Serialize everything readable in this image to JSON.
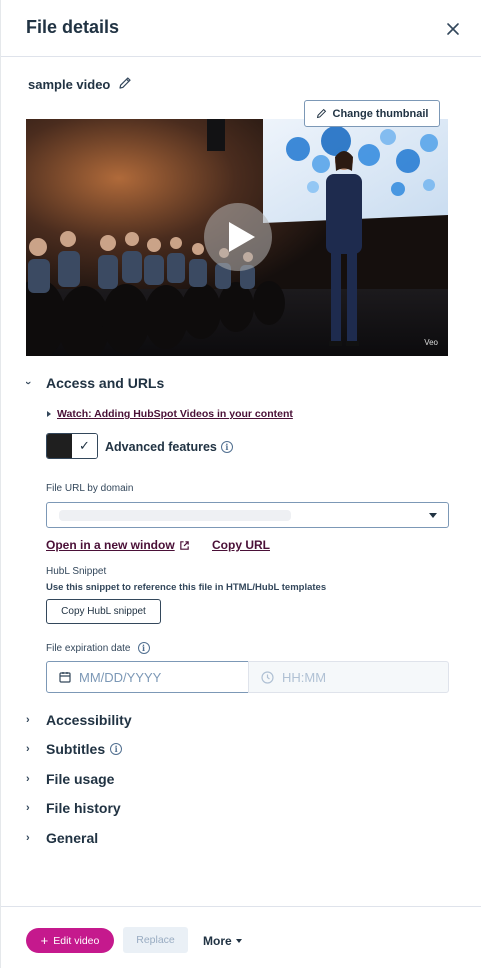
{
  "header": {
    "title": "File details"
  },
  "file": {
    "name": "sample video"
  },
  "video": {
    "change_thumbnail_label": "Change thumbnail",
    "watermark": "Veo"
  },
  "access": {
    "section_label": "Access and URLs",
    "watch_link": "Watch: Adding HubSpot Videos in your content",
    "advanced_features_label": "Advanced features",
    "file_url_label": "File URL by domain",
    "open_new_window_label": "Open in a new window",
    "copy_url_label": "Copy URL",
    "hubl_title": "HubL Snippet",
    "hubl_description": "Use this snippet to reference this file in HTML/HubL templates",
    "copy_hubl_label": "Copy HubL snippet",
    "expiration_label": "File expiration date",
    "date_placeholder": "MM/DD/YYYY",
    "time_placeholder": "HH:MM"
  },
  "sections": [
    "Accessibility",
    "Subtitles",
    "File usage",
    "File history",
    "General"
  ],
  "footer": {
    "edit_label": "Edit video",
    "replace_label": "Replace",
    "more_label": "More"
  },
  "colors": {
    "accent": "#c5198d",
    "link": "#4a1037",
    "text": "#213343"
  }
}
